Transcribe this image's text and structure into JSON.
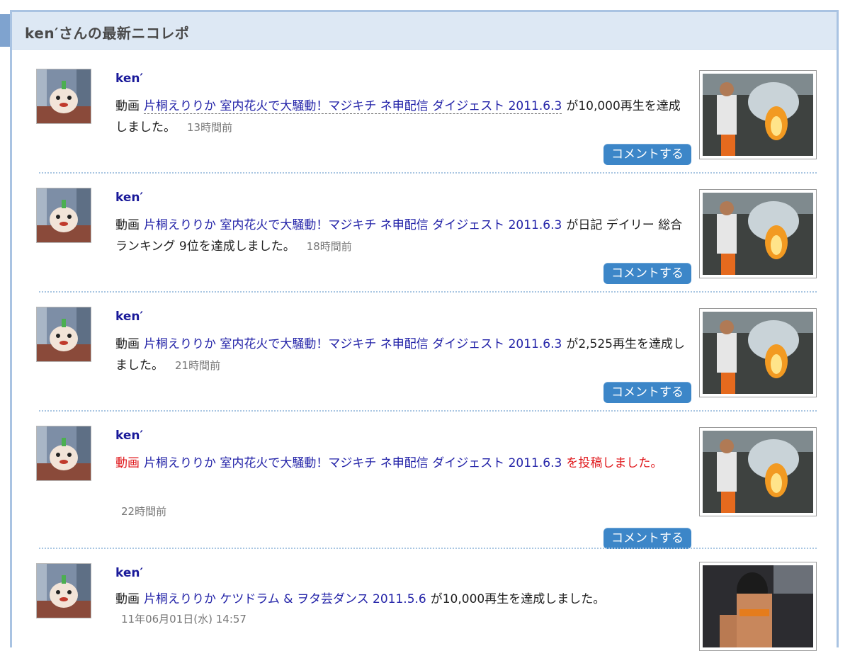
{
  "header": {
    "title": "ken′さんの最新ニコレポ"
  },
  "entries": [
    {
      "user": "ken′",
      "prefix": "動画",
      "video": "片桐えりりか 室内花火で大騒動！マジキチ ネ申配信 ダイジェスト 2011.6.3",
      "suffix": "が10,000再生を達成しました。",
      "time": "13時間前",
      "comment": "コメントする"
    },
    {
      "user": "ken′",
      "prefix": "動画",
      "video": "片桐えりりか 室内花火で大騒動！マジキチ ネ申配信 ダイジェスト 2011.6.3",
      "suffix": "が日記 デイリー 総合ランキング 9位を達成しました。",
      "time": "18時間前",
      "comment": "コメントする"
    },
    {
      "user": "ken′",
      "prefix": "動画",
      "video": "片桐えりりか 室内花火で大騒動！マジキチ ネ申配信 ダイジェスト 2011.6.3",
      "suffix": "が2,525再生を達成しました。",
      "time": "21時間前",
      "comment": "コメントする"
    },
    {
      "user": "ken′",
      "prefix": "動画",
      "video": "片桐えりりか 室内花火で大騒動！マジキチ ネ申配信 ダイジェスト 2011.6.3",
      "suffix": "を投稿しました。",
      "time": "22時間前",
      "comment": "コメントする"
    },
    {
      "user": "ken′",
      "prefix": "動画",
      "video": "片桐えりりか ケツドラム & ヲタ芸ダンス 2011.5.6",
      "suffix": "が10,000再生を達成しました。",
      "time": "11年06月01日(水) 14:57"
    }
  ],
  "colors": {
    "accent": "#3c86c8",
    "link": "#2323a8",
    "highlight": "#e0181c",
    "border": "#a9c3e2"
  }
}
